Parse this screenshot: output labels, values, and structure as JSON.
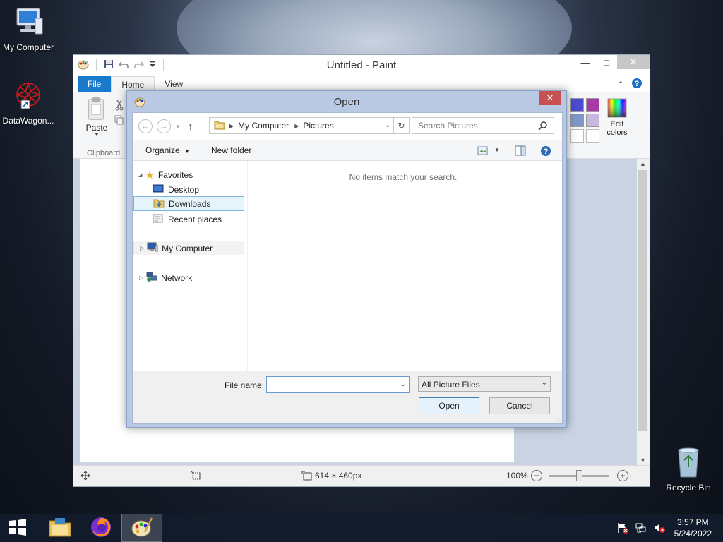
{
  "desktop": {
    "icons": [
      {
        "label": "My Computer"
      },
      {
        "label": "DataWagon..."
      },
      {
        "label": "Recycle Bin"
      }
    ]
  },
  "paint": {
    "title": "Untitled - Paint",
    "tabs": {
      "file": "File",
      "home": "Home",
      "view": "View"
    },
    "ribbon": {
      "paste": "Paste",
      "clipboard": "Clipboard",
      "edit_colors_1": "Edit",
      "edit_colors_2": "colors"
    },
    "colors": [
      "#4b4bd2",
      "#a83aa8",
      "#7f96c8",
      "#c8b8e0",
      "#ffffff",
      "#ffffff"
    ],
    "status": {
      "size": "614 × 460px",
      "zoom": "100%",
      "zoom_level": 0.5
    }
  },
  "dialog": {
    "title": "Open",
    "address": {
      "segment1": "My Computer",
      "segment2": "Pictures"
    },
    "search_placeholder": "Search Pictures",
    "toolbar": {
      "organize": "Organize",
      "new_folder": "New folder"
    },
    "nav": {
      "favorites": "Favorites",
      "desktop": "Desktop",
      "downloads": "Downloads",
      "recent": "Recent places",
      "computer": "My Computer",
      "network": "Network"
    },
    "empty_message": "No items match your search.",
    "file_name_label": "File name:",
    "file_name_value": "",
    "file_type": "All Picture Files",
    "open_button": "Open",
    "cancel_button": "Cancel"
  },
  "taskbar": {
    "time": "3:57 PM",
    "date": "5/24/2022"
  }
}
